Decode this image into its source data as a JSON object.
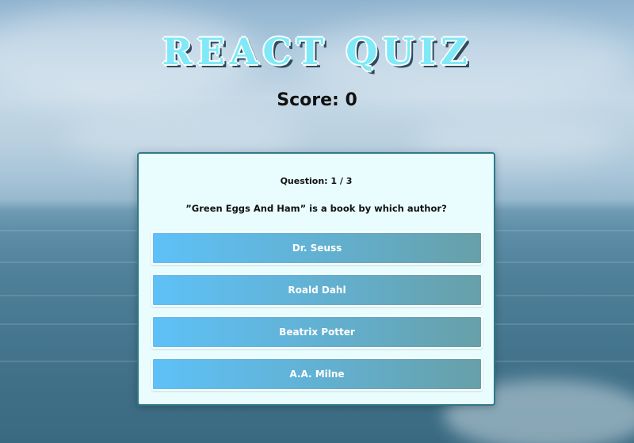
{
  "header": {
    "title": "REACT QUIZ",
    "score_label": "Score: 0"
  },
  "quiz": {
    "question_number": "Question: 1 / 3",
    "question_text": "”Green Eggs And Ham” is a book by which author?",
    "answers": [
      {
        "label": "Dr. Seuss"
      },
      {
        "label": "Roald Dahl"
      },
      {
        "label": "Beatrix Potter"
      },
      {
        "label": "A.A. Milne"
      }
    ]
  },
  "colors": {
    "title_fill": "#7fe9f7",
    "card_background": "#e9fdfe",
    "card_border": "#2c7a8a",
    "button_gradient_start": "#5ec1f7",
    "button_gradient_end": "#67a0a8"
  }
}
